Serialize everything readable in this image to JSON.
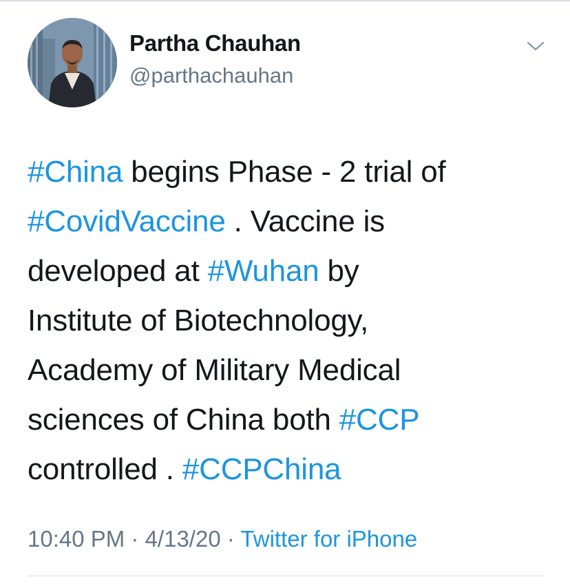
{
  "author": {
    "name": "Partha Chauhan",
    "handle": "@parthachauhan"
  },
  "tweet": {
    "lines": [
      [
        {
          "text": "#China",
          "kind": "hashtag"
        },
        {
          "text": " begins Phase - 2 trial of",
          "kind": "text"
        }
      ],
      [
        {
          "text": "#CovidVaccine",
          "kind": "hashtag"
        },
        {
          "text": " . Vaccine is",
          "kind": "text"
        }
      ],
      [
        {
          "text": "developed at ",
          "kind": "text"
        },
        {
          "text": "#Wuhan",
          "kind": "hashtag"
        },
        {
          "text": " by",
          "kind": "text"
        }
      ],
      [
        {
          "text": "Institute of Biotechnology,",
          "kind": "text"
        }
      ],
      [
        {
          "text": "Academy of Military Medical",
          "kind": "text"
        }
      ],
      [
        {
          "text": "sciences of China both ",
          "kind": "text"
        },
        {
          "text": "#CCP",
          "kind": "hashtag"
        }
      ],
      [
        {
          "text": "controlled . ",
          "kind": "text"
        },
        {
          "text": "#CCPChina",
          "kind": "hashtag"
        }
      ]
    ]
  },
  "meta": {
    "time": "10:40 PM",
    "separator": " · ",
    "date": "4/13/20",
    "source": "Twitter for iPhone"
  },
  "icons": {
    "menu": "chevron-down-icon",
    "avatar": "user-avatar-photo"
  },
  "colors": {
    "link": "#1b95e0",
    "secondary_text": "#657786",
    "primary_text": "#14171a",
    "divider": "#d8dde2"
  }
}
